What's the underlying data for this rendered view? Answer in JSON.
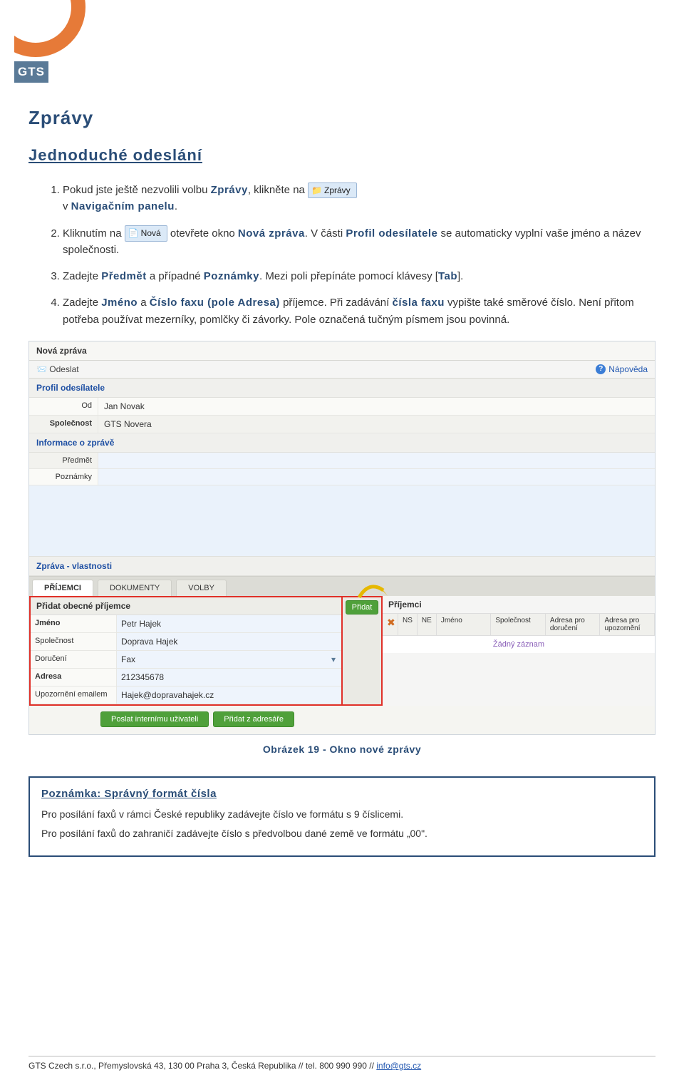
{
  "logo_text": "GTS",
  "title": "Zprávy",
  "subsection": "Jednoduché odeslání",
  "steps": {
    "s1_a": "Pokud jste ještě nezvolili volbu ",
    "s1_k": "Zprávy",
    "s1_b": ", klikněte na ",
    "s1_c": "v ",
    "s1_k2": "Navigačním panelu",
    "s1_d": ".",
    "btn_zpravy": "Zprávy",
    "s2_a": "Kliknutím na ",
    "btn_nova": "Nová",
    "s2_b": " otevřete okno ",
    "s2_k": "Nová zpráva",
    "s2_c": ". V části ",
    "s2_k2": "Profil odesílatele",
    "s2_d": " se automaticky vyplní vaše jméno a název společnosti.",
    "s3_a": "Zadejte ",
    "s3_k": "Předmět",
    "s3_b": " a případné ",
    "s3_k2": "Poznámky",
    "s3_c": ". Mezi poli přepínáte pomocí klávesy [",
    "s3_k3": "Tab",
    "s3_d": "].",
    "s4_a": "Zadejte ",
    "s4_k": "Jméno",
    "s4_b": " a ",
    "s4_k2": "Číslo faxu (pole Adresa)",
    "s4_c": " příjemce. Při zadávání ",
    "s4_k3": "čísla faxu",
    "s4_d": " vypište také směrové číslo. Není přitom potřeba používat mezerníky, pomlčky či závorky. Pole označená tučným písmem jsou povinná."
  },
  "shot": {
    "title": "Nová zpráva",
    "send": "Odeslat",
    "help": "Nápověda",
    "sec_sender": "Profil odesílatele",
    "lbl_from": "Od",
    "val_from": "Jan Novak",
    "lbl_company": "Společnost",
    "val_company": "GTS Novera",
    "sec_info": "Informace o zprávě",
    "lbl_subject": "Předmět",
    "lbl_notes": "Poznámky",
    "sec_props": "Zpráva - vlastnosti",
    "tab1": "PŘÍJEMCI",
    "tab2": "DOKUMENTY",
    "tab3": "VOLBY",
    "rec_title_left": "Přidat obecné příjemce",
    "rec_title_right": "Příjemci",
    "r_jmeno_l": "Jméno",
    "r_jmeno_v": "Petr Hajek",
    "r_spolecnost_l": "Společnost",
    "r_spolecnost_v": "Doprava Hajek",
    "r_doruceni_l": "Doručení",
    "r_doruceni_v": "Fax",
    "r_adresa_l": "Adresa",
    "r_adresa_v": "212345678",
    "r_upoz_l": "Upozornění emailem",
    "r_upoz_v": "Hajek@dopravahajek.cz",
    "btn_add": "Přidat",
    "col_ns": "NS",
    "col_ne": "NE",
    "col_jmeno": "Jméno",
    "col_spolecnost": "Společnost",
    "col_adr1": "Adresa pro doručení",
    "col_adr2": "Adresa pro upozornění",
    "empty": "Žádný záznam",
    "btn_internal": "Poslat internímu uživateli",
    "btn_addrbook": "Přidat z adresáře"
  },
  "caption": "Obrázek 19 - Okno nové zprávy",
  "note": {
    "title": "Poznámka: Správný formát čísla",
    "p1": "Pro posílání faxů v rámci České republiky zadávejte číslo ve formátu s 9 číslicemi.",
    "p2": "Pro posílání faxů do zahraničí zadávejte číslo s předvolbou dané země ve formátu „00\"."
  },
  "footer": {
    "text": "GTS Czech s.r.o., Přemyslovská 43, 130 00 Praha 3, Česká Republika // tel. 800 990 990  // ",
    "link": "info@gts.cz"
  }
}
